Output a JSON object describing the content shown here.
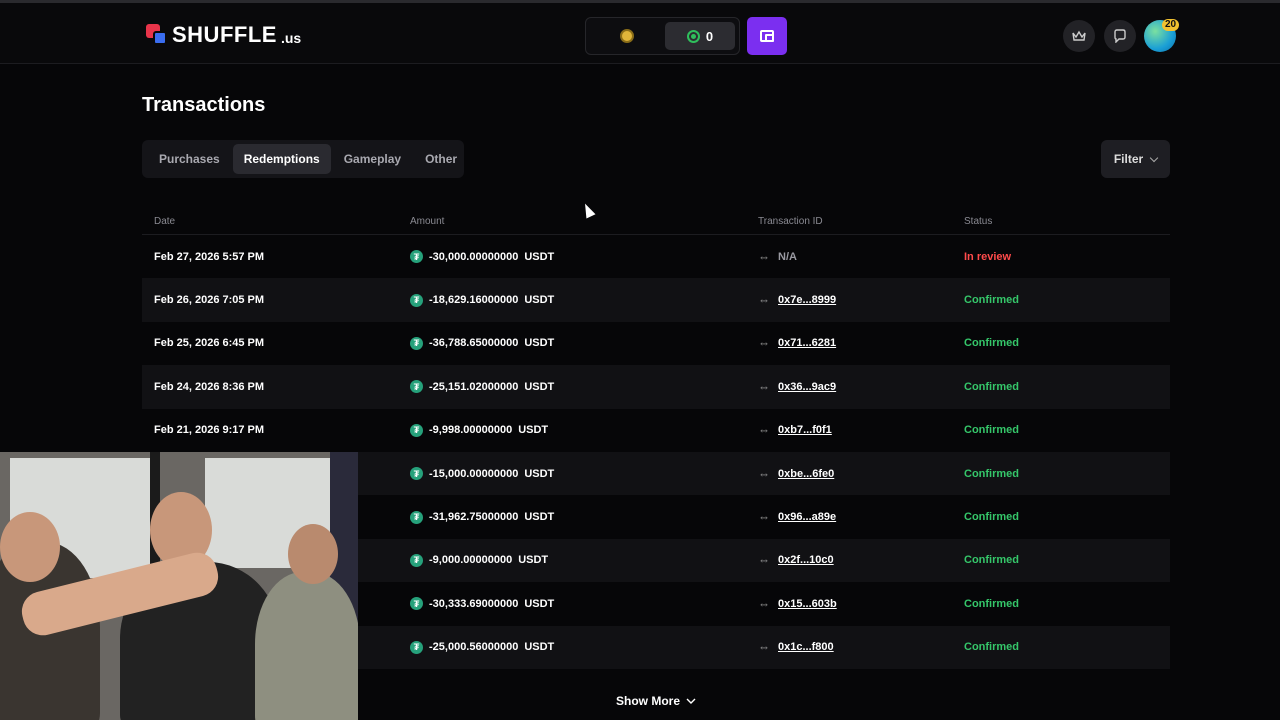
{
  "header": {
    "logo_text": "SHUFFLE",
    "logo_suffix": ".us",
    "sc_balance": "0",
    "avatar_level": "20",
    "icons": [
      "crown-icon",
      "chat-icon"
    ]
  },
  "page": {
    "title": "Transactions",
    "tabs": [
      "Purchases",
      "Redemptions",
      "Gameplay",
      "Other"
    ],
    "active_tab": "Redemptions",
    "filter_label": "Filter"
  },
  "table": {
    "columns": [
      "Date",
      "Amount",
      "Transaction ID",
      "Status"
    ],
    "rows": [
      {
        "date": "Feb 27, 2026 5:57 PM",
        "amount": "-30,000.00000000",
        "currency": "USDT",
        "tx": "N/A",
        "status": "In review"
      },
      {
        "date": "Feb 26, 2026 7:05 PM",
        "amount": "-18,629.16000000",
        "currency": "USDT",
        "tx": "0x7e...8999",
        "status": "Confirmed"
      },
      {
        "date": "Feb 25, 2026 6:45 PM",
        "amount": "-36,788.65000000",
        "currency": "USDT",
        "tx": "0x71...6281",
        "status": "Confirmed"
      },
      {
        "date": "Feb 24, 2026 8:36 PM",
        "amount": "-25,151.02000000",
        "currency": "USDT",
        "tx": "0x36...9ac9",
        "status": "Confirmed"
      },
      {
        "date": "Feb 21, 2026 9:17 PM",
        "amount": "-9,998.00000000",
        "currency": "USDT",
        "tx": "0xb7...f0f1",
        "status": "Confirmed"
      },
      {
        "date": "",
        "amount": "-15,000.00000000",
        "currency": "USDT",
        "tx": "0xbe...6fe0",
        "status": "Confirmed"
      },
      {
        "date": "",
        "amount": "-31,962.75000000",
        "currency": "USDT",
        "tx": "0x96...a89e",
        "status": "Confirmed"
      },
      {
        "date": "",
        "amount": "-9,000.00000000",
        "currency": "USDT",
        "tx": "0x2f...10c0",
        "status": "Confirmed"
      },
      {
        "date": "",
        "amount": "-30,333.69000000",
        "currency": "USDT",
        "tx": "0x15...603b",
        "status": "Confirmed"
      },
      {
        "date": "",
        "amount": "-25,000.56000000",
        "currency": "USDT",
        "tx": "0x1c...f800",
        "status": "Confirmed"
      }
    ]
  },
  "show_more_label": "Show More",
  "colors": {
    "accent": "#7b2ff0",
    "confirmed": "#35c76a",
    "in_review": "#ff4b4b",
    "tether": "#26a17b"
  }
}
